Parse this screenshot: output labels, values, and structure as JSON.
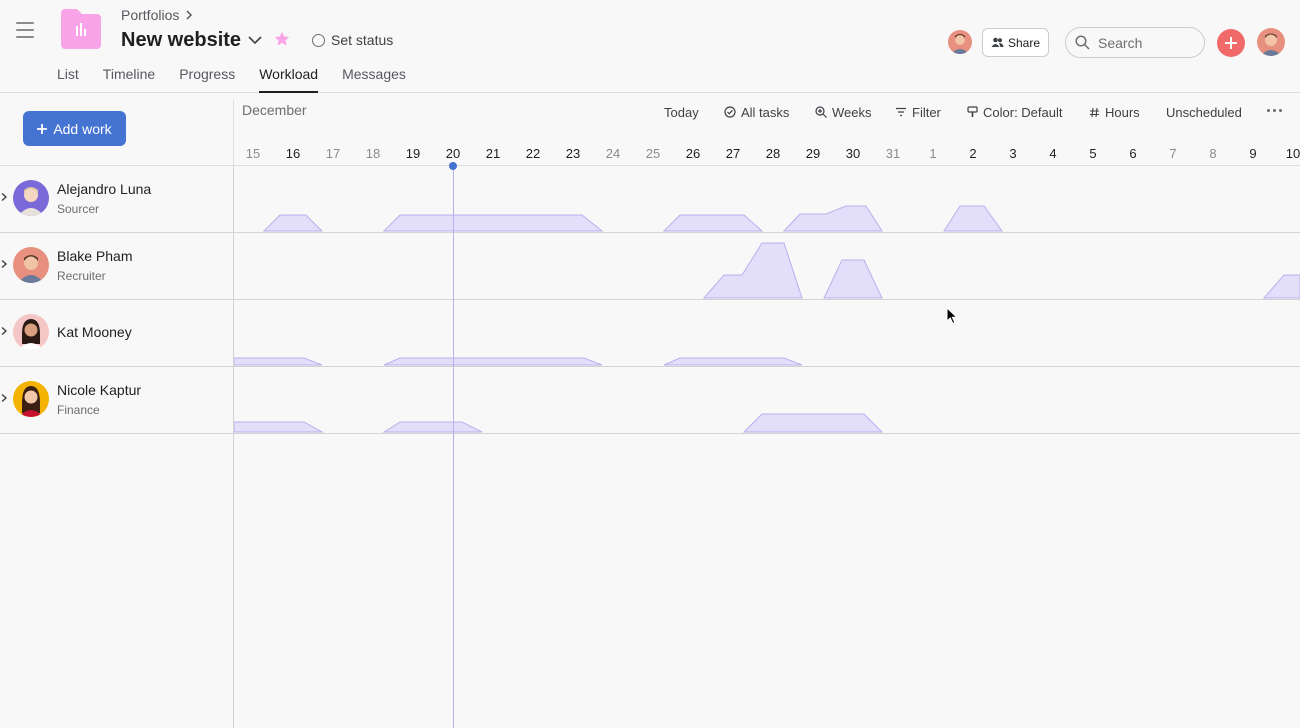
{
  "breadcrumb": {
    "parent": "Portfolios"
  },
  "project": {
    "title": "New website",
    "status_label": "Set status"
  },
  "tabs": [
    {
      "label": "List"
    },
    {
      "label": "Timeline"
    },
    {
      "label": "Progress"
    },
    {
      "label": "Workload",
      "active": true
    },
    {
      "label": "Messages"
    }
  ],
  "topbar": {
    "share_label": "Share",
    "search_placeholder": "Search"
  },
  "toolbar": {
    "add_work_label": "Add work",
    "month": "December",
    "today": "Today",
    "all_tasks": "All tasks",
    "weeks": "Weeks",
    "filter": "Filter",
    "color": "Color: Default",
    "hours": "Hours",
    "unscheduled": "Unscheduled"
  },
  "days": [
    {
      "label": "15",
      "weekend": true
    },
    {
      "label": "16",
      "weekend": false
    },
    {
      "label": "17",
      "weekend": true
    },
    {
      "label": "18",
      "weekend": true
    },
    {
      "label": "19",
      "weekend": false
    },
    {
      "label": "20",
      "weekend": false
    },
    {
      "label": "21",
      "weekend": false
    },
    {
      "label": "22",
      "weekend": false
    },
    {
      "label": "23",
      "weekend": false
    },
    {
      "label": "24",
      "weekend": true
    },
    {
      "label": "25",
      "weekend": true
    },
    {
      "label": "26",
      "weekend": false
    },
    {
      "label": "27",
      "weekend": false
    },
    {
      "label": "28",
      "weekend": false
    },
    {
      "label": "29",
      "weekend": false
    },
    {
      "label": "30",
      "weekend": false
    },
    {
      "label": "31",
      "weekend": true
    },
    {
      "label": "1",
      "weekend": true
    },
    {
      "label": "2",
      "weekend": false
    },
    {
      "label": "3",
      "weekend": false
    },
    {
      "label": "4",
      "weekend": false
    },
    {
      "label": "5",
      "weekend": false
    },
    {
      "label": "6",
      "weekend": false
    },
    {
      "label": "7",
      "weekend": true
    },
    {
      "label": "8",
      "weekend": true
    },
    {
      "label": "9",
      "weekend": false
    },
    {
      "label": "10",
      "weekend": false
    }
  ],
  "people": [
    {
      "name": "Alejandro Luna",
      "role": "Sourcer",
      "avatar_bg": "#7b68d9"
    },
    {
      "name": "Blake Pham",
      "role": "Recruiter",
      "avatar_bg": "#e8907f"
    },
    {
      "name": "Kat Mooney",
      "role": "",
      "avatar_bg": "#f5c6c6"
    },
    {
      "name": "Nicole Kaptur",
      "role": "Finance",
      "avatar_bg": "#f3b300"
    }
  ],
  "colors": {
    "accent": "#4573d2",
    "workload_fill": "#e3dffa",
    "workload_stroke": "#b7b1ec",
    "add_button": "#f06a6a",
    "project_icon": "#f9a4e8"
  }
}
